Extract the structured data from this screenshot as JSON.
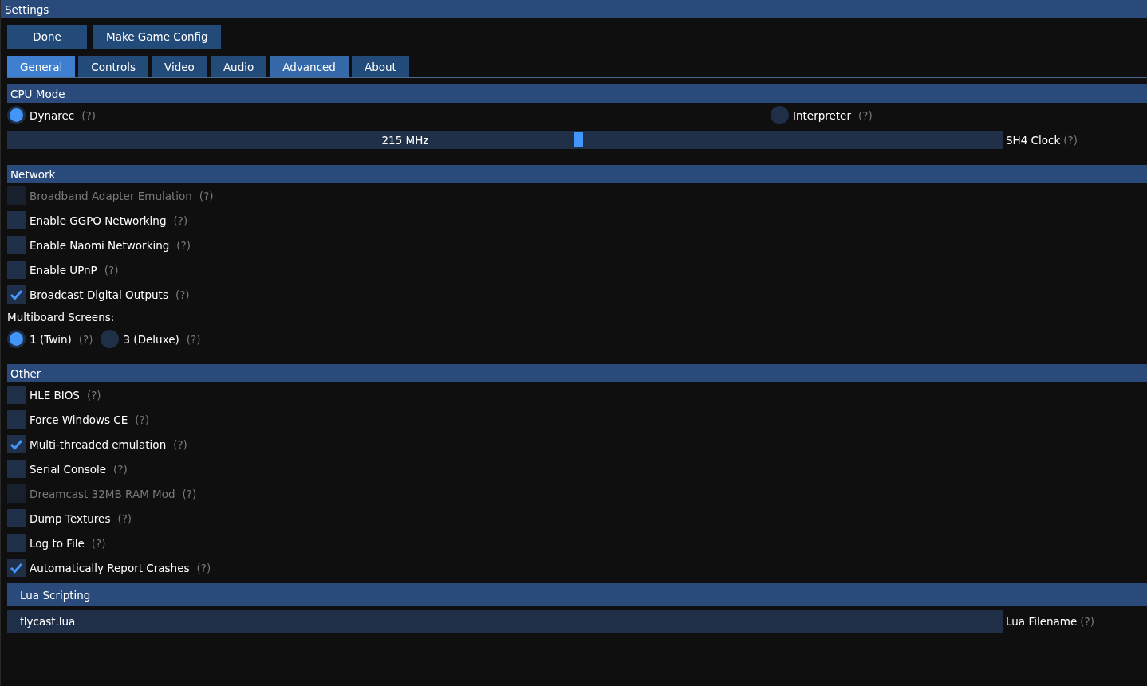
{
  "window": {
    "title": "Settings"
  },
  "buttons": [
    "Done",
    "Make Game Config"
  ],
  "tabs": [
    {
      "label": "General",
      "selected": true,
      "hovered": false
    },
    {
      "label": "Controls",
      "selected": false,
      "hovered": false
    },
    {
      "label": "Video",
      "selected": false,
      "hovered": false
    },
    {
      "label": "Audio",
      "selected": false,
      "hovered": false
    },
    {
      "label": "Advanced",
      "selected": false,
      "hovered": true
    },
    {
      "label": "About",
      "selected": false,
      "hovered": false
    }
  ],
  "sections": [
    {
      "kind": "separator",
      "title": "CPU Mode",
      "items": [
        {
          "kind": "radio_columns",
          "options": [
            {
              "label": "Dynarec",
              "help": "(?)",
              "selected": true
            },
            {
              "label": "Interpreter",
              "help": "(?)",
              "selected": false
            }
          ]
        },
        {
          "kind": "slider",
          "reading": "215 MHz",
          "level": 0.574,
          "label": "SH4 Clock",
          "help": "(?)"
        }
      ]
    },
    {
      "kind": "separator",
      "title": "Network",
      "items": [
        {
          "kind": "checkbox",
          "label": "Broadband Adapter Emulation",
          "help": "(?)",
          "checked": false,
          "disabled": true
        },
        {
          "kind": "checkbox",
          "label": "Enable GGPO Networking",
          "help": "(?)",
          "checked": false,
          "disabled": false
        },
        {
          "kind": "checkbox",
          "label": "Enable Naomi Networking",
          "help": "(?)",
          "checked": false,
          "disabled": false
        },
        {
          "kind": "checkbox",
          "label": "Enable UPnP",
          "help": "(?)",
          "checked": false,
          "disabled": false
        },
        {
          "kind": "checkbox",
          "label": "Broadcast Digital Outputs",
          "help": "(?)",
          "checked": true,
          "disabled": false
        },
        {
          "kind": "text",
          "label": "Multiboard Screens:"
        },
        {
          "kind": "radio_inline",
          "options": [
            {
              "label": "1 (Twin)",
              "help": "(?)",
              "selected": true
            },
            {
              "label": "3 (Deluxe)",
              "help": "(?)",
              "selected": false
            }
          ]
        }
      ]
    },
    {
      "kind": "separator",
      "title": "Other",
      "items": [
        {
          "kind": "checkbox",
          "label": "HLE BIOS",
          "help": "(?)",
          "checked": false,
          "disabled": false
        },
        {
          "kind": "checkbox",
          "label": "Force Windows CE",
          "help": "(?)",
          "checked": false,
          "disabled": false
        },
        {
          "kind": "checkbox",
          "label": "Multi-threaded emulation",
          "help": "(?)",
          "checked": true,
          "disabled": false
        },
        {
          "kind": "checkbox",
          "label": "Serial Console",
          "help": "(?)",
          "checked": false,
          "disabled": false
        },
        {
          "kind": "checkbox",
          "label": "Dreamcast 32MB RAM Mod",
          "help": "(?)",
          "checked": false,
          "disabled": true
        },
        {
          "kind": "checkbox",
          "label": "Dump Textures",
          "help": "(?)",
          "checked": false,
          "disabled": false
        },
        {
          "kind": "checkbox",
          "label": "Log to File",
          "help": "(?)",
          "checked": false,
          "disabled": false
        },
        {
          "kind": "checkbox",
          "label": "Automatically Report Crashes",
          "help": "(?)",
          "checked": true,
          "disabled": false
        }
      ]
    },
    {
      "kind": "collapsing",
      "title": "Lua Scripting",
      "items": [
        {
          "kind": "field",
          "value": "flycast.lua",
          "label": "Lua Filename",
          "help": "(?)"
        }
      ]
    }
  ]
}
